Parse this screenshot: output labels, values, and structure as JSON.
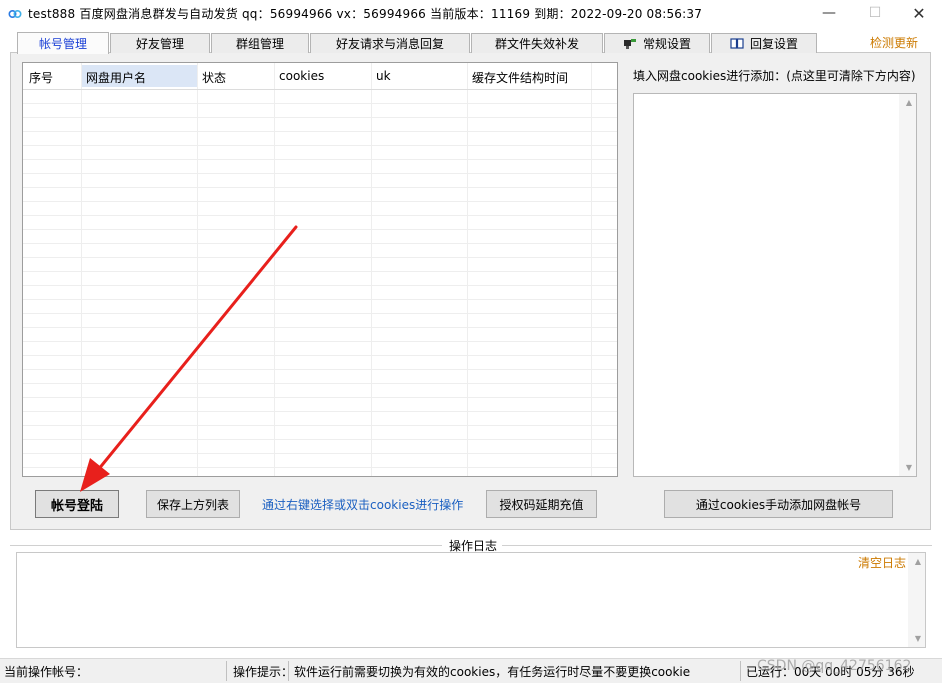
{
  "window": {
    "title": "test888   百度网盘消息群发与自动发货    qq：56994966   vx：56994966     当前版本：11169   到期：2022-09-20 08:56:37",
    "minimize": "—",
    "maximize": "☐",
    "close": "✕"
  },
  "tabs": [
    {
      "label": "帐号管理",
      "active": true
    },
    {
      "label": "好友管理"
    },
    {
      "label": "群组管理"
    },
    {
      "label": "好友请求与消息回复"
    },
    {
      "label": "群文件失效补发"
    },
    {
      "label": "常规设置",
      "icon": "settings-tools-icon"
    },
    {
      "label": "回复设置",
      "icon": "book-icon"
    }
  ],
  "check_update": "检测更新",
  "table": {
    "columns": [
      "序号",
      "网盘用户名",
      "状态",
      "cookies",
      "uk",
      "缓存文件结构时间"
    ],
    "rows": []
  },
  "buttons": {
    "login": "帐号登陆",
    "save_list": "保存上方列表",
    "extend": "授权码延期充值",
    "add_cookie": "通过cookies手动添加网盘帐号"
  },
  "hint": "通过右键选择或双击cookies进行操作",
  "cookie_panel": {
    "label": "填入网盘cookies进行添加：(点这里可清除下方内容)",
    "value": ""
  },
  "log": {
    "title": "操作日志",
    "clear": "清空日志"
  },
  "status": {
    "current_account_label": "当前操作帐号：",
    "tip_label": "操作提示：",
    "tip_text": "软件运行前需要切换为有效的cookies，有任务运行时尽量不要更换cookie",
    "runtime": "已运行：00天 00时 05分 36秒",
    "watermark": "CSDN @qq_42756162"
  },
  "colors": {
    "active_tab_text": "#1a3fd6",
    "accent_orange": "#cc7a00",
    "link_blue": "#1a5fc1",
    "annotation_red": "#e8201c"
  }
}
